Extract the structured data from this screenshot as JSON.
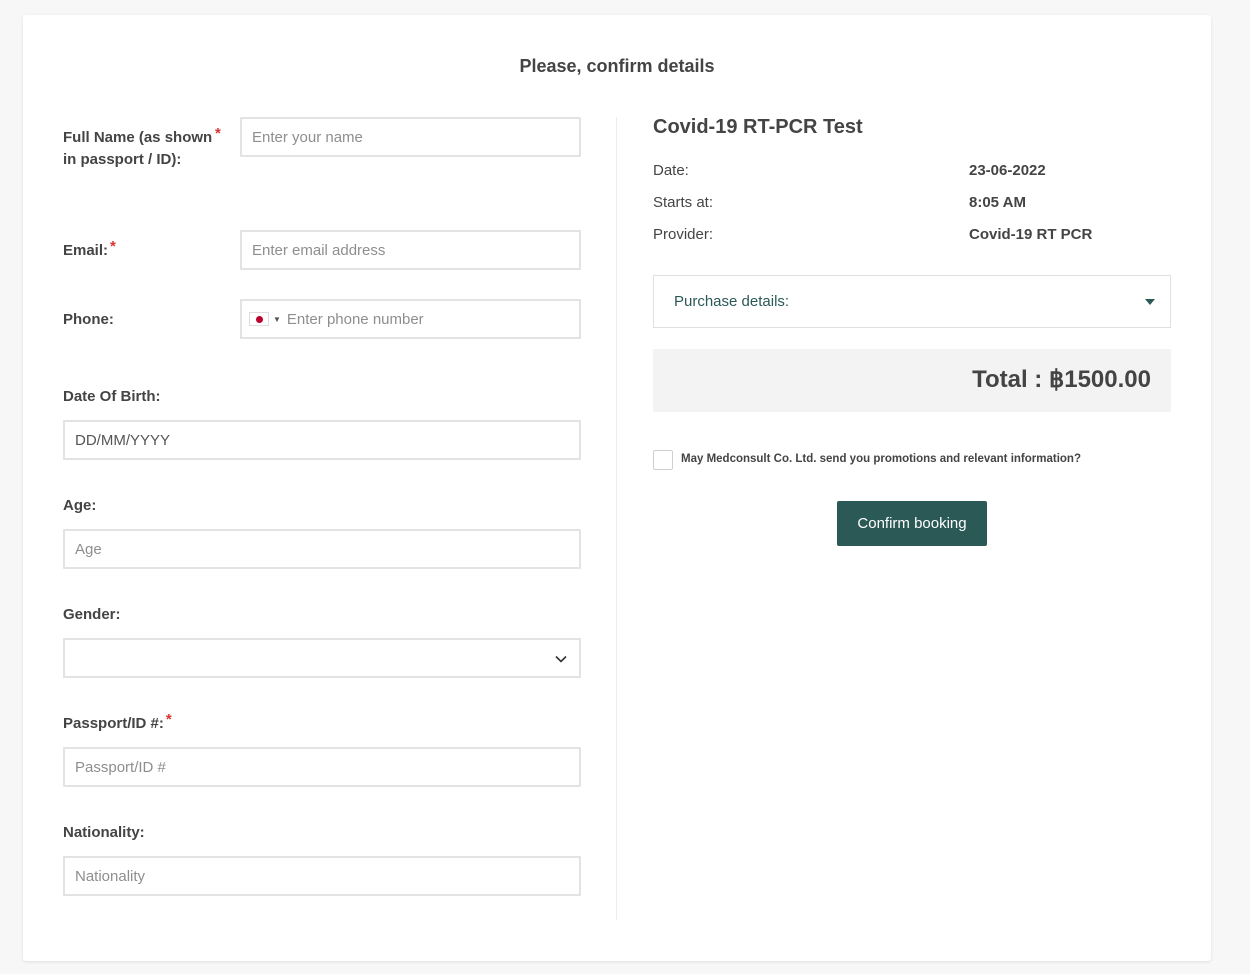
{
  "page": {
    "title": "Please, confirm details"
  },
  "form": {
    "full_name": {
      "label": "Full Name (as shown in passport / ID):",
      "required_mark": "*",
      "placeholder": "Enter your name"
    },
    "email": {
      "label": "Email:",
      "required_mark": "*",
      "placeholder": "Enter email address"
    },
    "phone": {
      "label": "Phone:",
      "country_flag": "japan-flag-icon",
      "placeholder": "Enter phone number"
    },
    "dob": {
      "label": "Date Of Birth:",
      "placeholder": "DD/MM/YYYY"
    },
    "age": {
      "label": "Age:",
      "placeholder": "Age"
    },
    "gender": {
      "label": "Gender:",
      "value": ""
    },
    "passport": {
      "label": "Passport/ID #:",
      "required_mark": "*",
      "placeholder": "Passport/ID #"
    },
    "nationality": {
      "label": "Nationality:",
      "placeholder": "Nationality"
    }
  },
  "summary": {
    "service_title": "Covid-19 RT-PCR Test",
    "details": [
      {
        "key": "Date:",
        "value": "23-06-2022"
      },
      {
        "key": "Starts at:",
        "value": "8:05 AM"
      },
      {
        "key": "Provider:",
        "value": "Covid-19 RT PCR"
      }
    ],
    "purchase_details_label": "Purchase details:",
    "total": "Total : ฿1500.00",
    "promo_consent": "May Medconsult Co. Ltd. send you promotions and relevant information?",
    "confirm_label": "Confirm booking"
  },
  "colors": {
    "accent": "#2b5956",
    "required": "#d9332e",
    "border": "#e3e3e3"
  }
}
